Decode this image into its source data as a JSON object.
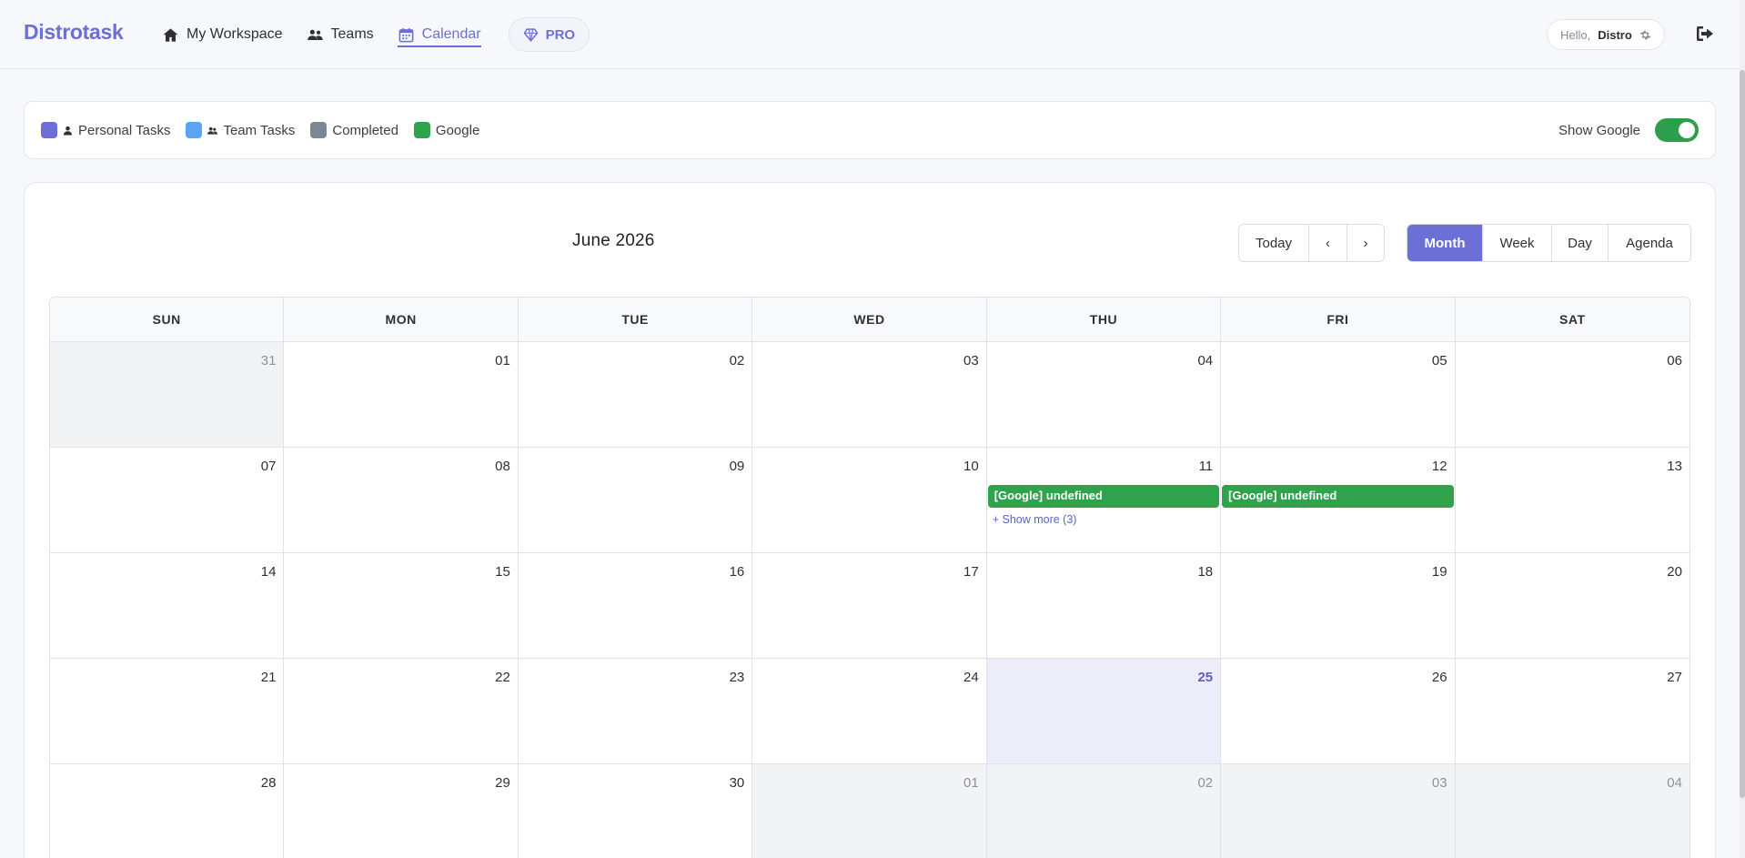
{
  "header": {
    "brand": "Distrotask",
    "nav": [
      {
        "label": "My Workspace",
        "icon": "home-icon"
      },
      {
        "label": "Teams",
        "icon": "users-icon"
      },
      {
        "label": "Calendar",
        "icon": "calendar-icon",
        "active": true
      }
    ],
    "pro_label": "PRO",
    "hello_label": "Hello,",
    "user_name": "Distro"
  },
  "legend": {
    "items": [
      {
        "label": "Personal Tasks",
        "color": "#6b6fd6",
        "icon": "user-icon"
      },
      {
        "label": "Team Tasks",
        "color": "#5aa6f5",
        "icon": "users-icon"
      },
      {
        "label": "Completed",
        "color": "#7d8794"
      },
      {
        "label": "Google",
        "color": "#2fa24c"
      }
    ],
    "show_google_label": "Show Google",
    "show_google_on": true
  },
  "calendar": {
    "title": "June 2026",
    "nav_buttons": {
      "today": "Today",
      "prev": "‹",
      "next": "›"
    },
    "views": [
      "Month",
      "Week",
      "Day",
      "Agenda"
    ],
    "active_view": "Month",
    "weekdays": [
      "SUN",
      "MON",
      "TUE",
      "WED",
      "THU",
      "FRI",
      "SAT"
    ],
    "weeks": [
      [
        {
          "d": "31",
          "other": true
        },
        {
          "d": "01"
        },
        {
          "d": "02"
        },
        {
          "d": "03"
        },
        {
          "d": "04"
        },
        {
          "d": "05"
        },
        {
          "d": "06"
        }
      ],
      [
        {
          "d": "07"
        },
        {
          "d": "08"
        },
        {
          "d": "09"
        },
        {
          "d": "10"
        },
        {
          "d": "11",
          "event": "[Google] undefined",
          "more": "+ Show more (3)"
        },
        {
          "d": "12",
          "event": "[Google] undefined"
        },
        {
          "d": "13"
        }
      ],
      [
        {
          "d": "14"
        },
        {
          "d": "15"
        },
        {
          "d": "16"
        },
        {
          "d": "17"
        },
        {
          "d": "18"
        },
        {
          "d": "19"
        },
        {
          "d": "20"
        }
      ],
      [
        {
          "d": "21"
        },
        {
          "d": "22"
        },
        {
          "d": "23"
        },
        {
          "d": "24"
        },
        {
          "d": "25",
          "today": true
        },
        {
          "d": "26"
        },
        {
          "d": "27"
        }
      ],
      [
        {
          "d": "28"
        },
        {
          "d": "29"
        },
        {
          "d": "30"
        },
        {
          "d": "01",
          "other": true
        },
        {
          "d": "02",
          "other": true
        },
        {
          "d": "03",
          "other": true
        },
        {
          "d": "04",
          "other": true
        }
      ]
    ]
  }
}
